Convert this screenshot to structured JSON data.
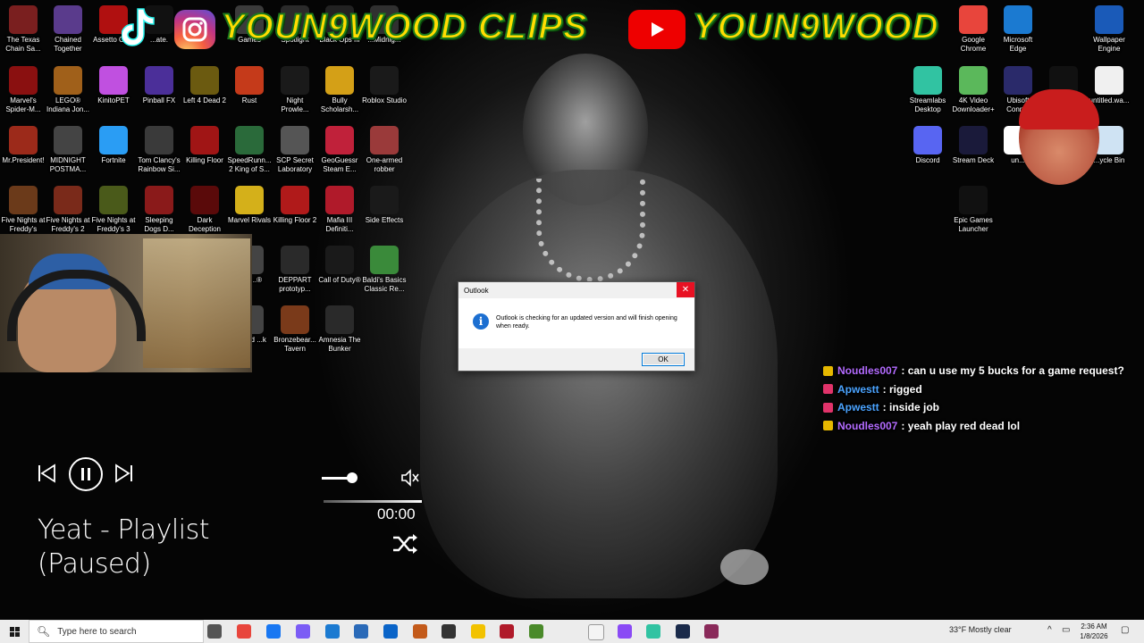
{
  "banner": {
    "text_left": "YOUN9WOOD CLIPS",
    "text_right": "YOUN9WOOD"
  },
  "desktop_icons_left": [
    {
      "label": "The Texas Chain Sa...",
      "icon": "texas-chainsaw-icon",
      "color": "#7a1f1f"
    },
    {
      "label": "Chained Together",
      "icon": "chained-together-icon",
      "color": "#5a3b8c"
    },
    {
      "label": "Assetto Co...",
      "icon": "assetto-corsa-icon",
      "color": "#b01010"
    },
    {
      "label": "...ate.",
      "icon": "tiktok-icon",
      "color": "#111111"
    },
    {
      "label": "Games",
      "icon": "games-folder-icon",
      "color": "#3b3b3b"
    },
    {
      "label": "Spotlight",
      "icon": "spotlight-icon",
      "color": "#2b2b2b"
    },
    {
      "label": "Black Ops III",
      "icon": "black-ops-icon",
      "color": "#222222"
    },
    {
      "label": "...Midnig...",
      "icon": "midnight-icon",
      "color": "#303030"
    },
    {
      "label": "Marvel's Spider-M...",
      "icon": "spiderman-icon",
      "color": "#8a1010"
    },
    {
      "label": "LEGO® Indiana Jon...",
      "icon": "lego-indiana-icon",
      "color": "#a0601a"
    },
    {
      "label": "KinitoPET",
      "icon": "kinitopet-icon",
      "color": "#c050e0"
    },
    {
      "label": "Pinball FX",
      "icon": "pinball-icon",
      "color": "#4b2f99"
    },
    {
      "label": "Left 4 Dead 2",
      "icon": "left4dead-icon",
      "color": "#6b5a10"
    },
    {
      "label": "Rust",
      "icon": "rust-icon",
      "color": "#c53a1a"
    },
    {
      "label": "Night Prowle...",
      "icon": "night-prowler-icon",
      "color": "#1a1a1a"
    },
    {
      "label": "Bully Scholarsh...",
      "icon": "bully-icon",
      "color": "#d4a017"
    },
    {
      "label": "Roblox Studio",
      "icon": "roblox-studio-icon",
      "color": "#1a1a1a"
    },
    {
      "label": "Mr.President!",
      "icon": "mr-president-icon",
      "color": "#9c2a1a"
    },
    {
      "label": "MIDNIGHT POSTMA...",
      "icon": "midnight-postman-icon",
      "color": "#444444"
    },
    {
      "label": "Fortnite",
      "icon": "fortnite-icon",
      "color": "#2a9df4"
    },
    {
      "label": "Tom Clancy's Rainbow Si...",
      "icon": "rainbow-six-icon",
      "color": "#3a3a3a"
    },
    {
      "label": "Killing Floor",
      "icon": "killing-floor-icon",
      "color": "#a01515"
    },
    {
      "label": "SpeedRunn... 2 King of S...",
      "icon": "speedrunners-icon",
      "color": "#2a6a3a"
    },
    {
      "label": "SCP Secret Laboratory",
      "icon": "scp-icon",
      "color": "#555555"
    },
    {
      "label": "GeoGuessr Steam E...",
      "icon": "geoguessr-icon",
      "color": "#c0213a"
    },
    {
      "label": "One-armed robber",
      "icon": "one-armed-robber-icon",
      "color": "#9a3a3a"
    },
    {
      "label": "Five Nights at Freddy's",
      "icon": "fnaf1-icon",
      "color": "#6b3a1a"
    },
    {
      "label": "Five Nights at Freddy's 2",
      "icon": "fnaf2-icon",
      "color": "#7a2a1a"
    },
    {
      "label": "Five Nights at Freddy's 3",
      "icon": "fnaf3-icon",
      "color": "#4a5a1a"
    },
    {
      "label": "Sleeping Dogs D...",
      "icon": "sleeping-dogs-icon",
      "color": "#8a1a1a"
    },
    {
      "label": "Dark Deception",
      "icon": "dark-deception-icon",
      "color": "#5a0a0a"
    },
    {
      "label": "Marvel Rivals",
      "icon": "marvel-rivals-icon",
      "color": "#d4b01a"
    },
    {
      "label": "Killing Floor 2",
      "icon": "killing-floor2-icon",
      "color": "#b01a1a"
    },
    {
      "label": "Mafia III Definiti...",
      "icon": "mafia-icon",
      "color": "#b01a2a"
    },
    {
      "label": "Side Effects",
      "icon": "side-effects-icon",
      "color": "#1a1a1a"
    },
    {
      "label": "...of ...®",
      "icon": "game-partial-icon",
      "color": "#444444"
    },
    {
      "label": "DEPPART prototyp...",
      "icon": "deppart-icon",
      "color": "#2a2a2a"
    },
    {
      "label": "Call of Duty®",
      "icon": "call-of-duty-icon",
      "color": "#1a1a1a"
    },
    {
      "label": "Baldi's Basics Classic Re...",
      "icon": "baldi-icon",
      "color": "#3a8a3a"
    },
    {
      "label": "...rmed ...k",
      "icon": "game-partial2-icon",
      "color": "#444444"
    },
    {
      "label": "Bronzebear... Tavern",
      "icon": "bronzebeard-icon",
      "color": "#7a3a1a"
    },
    {
      "label": "Amnesia The Bunker",
      "icon": "amnesia-icon",
      "color": "#2a2a2a"
    }
  ],
  "desktop_icons_right": [
    {
      "label": "Google Chrome",
      "icon": "chrome-icon",
      "color": "#e8453c"
    },
    {
      "label": "Microsoft Edge",
      "icon": "edge-icon",
      "color": "#1b7ad1"
    },
    {
      "label": "Wallpaper Engine",
      "icon": "wallpaper-engine-icon",
      "color": "#1a5ab8"
    },
    {
      "label": "Streamlabs Desktop",
      "icon": "streamlabs-icon",
      "color": "#31c3a2"
    },
    {
      "label": "4K Video Downloader+",
      "icon": "4k-downloader-icon",
      "color": "#5bb85b"
    },
    {
      "label": "Ubisoft Conn...",
      "icon": "ubisoft-icon",
      "color": "#2a2a6a"
    },
    {
      "label": "",
      "icon": "capcut-icon",
      "color": "#111111"
    },
    {
      "label": "untitled.wa...",
      "icon": "file-icon",
      "color": "#f0f0f0"
    },
    {
      "label": "Discord",
      "icon": "discord-icon",
      "color": "#5865f2"
    },
    {
      "label": "Stream Deck",
      "icon": "stream-deck-icon",
      "color": "#1a1a3a"
    },
    {
      "label": "un...",
      "icon": "unknown-icon",
      "color": "#ffffff"
    },
    {
      "label": "...ycle Bin",
      "icon": "recycle-bin-icon",
      "color": "#cfe3f3"
    },
    {
      "label": "Epic Games Launcher",
      "icon": "epic-games-icon",
      "color": "#111111"
    }
  ],
  "player": {
    "song": "Yeat - Playlist",
    "status": "(Paused)",
    "time": "00:00",
    "volume": 0.8
  },
  "dialog": {
    "title": "Outlook",
    "message": "Outlook is checking for an updated version and will finish opening when ready.",
    "ok_label": "OK",
    "close_glyph": "✕"
  },
  "chat": [
    {
      "user": "Noudles007",
      "message": ": can u use my 5 bucks for a game request?",
      "user_color": "#b36bff",
      "badge_color": "#e6b800"
    },
    {
      "user": "Apwestt",
      "message": ": rigged",
      "user_color": "#4aa3ff",
      "badge_color": "#e0336a"
    },
    {
      "user": "Apwestt",
      "message": ": inside job",
      "user_color": "#4aa3ff",
      "badge_color": "#e0336a"
    },
    {
      "user": "Noudles007",
      "message": ": yeah play red dead lol",
      "user_color": "#b36bff",
      "badge_color": "#e6b800"
    }
  ],
  "taskbar": {
    "search_placeholder": "Type here to search",
    "weather": "33°F  Mostly clear",
    "time": "2:36 AM",
    "date": "1/8/2026",
    "apps": [
      {
        "icon": "task-view-icon",
        "color": "#555555"
      },
      {
        "icon": "chrome-icon",
        "color": "#e8453c"
      },
      {
        "icon": "facebook-icon",
        "color": "#1877f2"
      },
      {
        "icon": "copilot-icon",
        "color": "#7b5cf5"
      },
      {
        "icon": "edge-icon",
        "color": "#1b7ad1"
      },
      {
        "icon": "calculator-icon",
        "color": "#2a6ab8"
      },
      {
        "icon": "outlook-icon",
        "color": "#0a64c8"
      },
      {
        "icon": "photoshop-icon",
        "color": "#c35a1a"
      },
      {
        "icon": "roblox-icon",
        "color": "#333333"
      },
      {
        "icon": "file-explorer-icon",
        "color": "#f2c200"
      },
      {
        "icon": "media-icon",
        "color": "#b01a2a"
      },
      {
        "icon": "minecraft-icon",
        "color": "#4a8a2a"
      },
      {
        "icon": "notepad-icon",
        "color": "#f4f4f4"
      },
      {
        "icon": "messenger-icon",
        "color": "#8a4af5"
      },
      {
        "icon": "streamlabs-icon",
        "color": "#31c3a2"
      },
      {
        "icon": "steam-icon",
        "color": "#1a2a4a"
      },
      {
        "icon": "winrar-icon",
        "color": "#8a2a5a"
      }
    ]
  }
}
